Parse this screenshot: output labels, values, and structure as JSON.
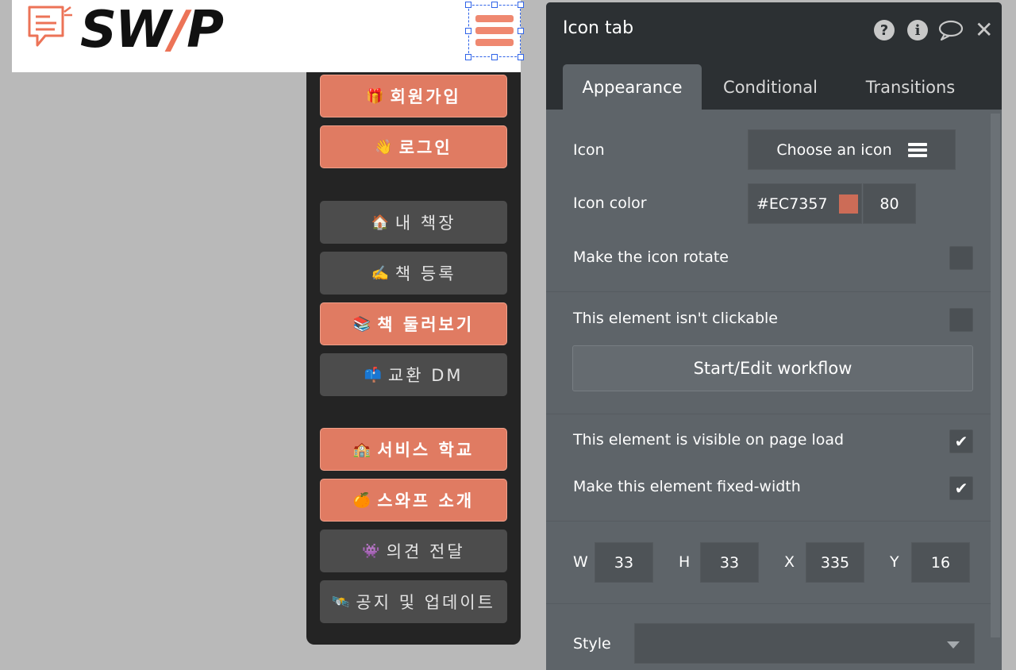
{
  "header": {
    "logo_text": "SWAP",
    "logo_text_main": "SW",
    "logo_text_accent": "/",
    "logo_text_tail": "P",
    "logo_icon": "document-chat-icon",
    "menu_icon": "hamburger-menu-icon"
  },
  "colors": {
    "accent": "#EC7357",
    "menu_dark": "#242424",
    "panel_bg": "#5e6469",
    "panel_header": "#2c3033"
  },
  "menu": {
    "items": [
      {
        "emoji": "🎁",
        "label": "회원가입",
        "style": "orange"
      },
      {
        "emoji": "👋",
        "label": "로그인",
        "style": "orange"
      },
      {
        "emoji": "🏠",
        "label": "내 책장",
        "style": "gray"
      },
      {
        "emoji": "✍️",
        "label": "책 등록",
        "style": "gray"
      },
      {
        "emoji": "📚",
        "label": "책 둘러보기",
        "style": "orange"
      },
      {
        "emoji": "📫",
        "label": "교환 DM",
        "style": "gray"
      },
      {
        "emoji": "🏫",
        "label": "서비스 학교",
        "style": "orange"
      },
      {
        "emoji": "🍊",
        "label": "스와프 소개",
        "style": "orange"
      },
      {
        "emoji": "👾",
        "label": "의견 전달",
        "style": "gray"
      },
      {
        "emoji": "🛰️",
        "label": "공지 및 업데이트",
        "style": "gray"
      }
    ]
  },
  "panel": {
    "title": "Icon tab",
    "help_icon": "?",
    "info_icon": "i",
    "tabs": [
      "Appearance",
      "Conditional",
      "Transitions"
    ],
    "icon_label": "Icon",
    "icon_button": "Choose an icon",
    "icon_color_label": "Icon color",
    "icon_color_value": "#EC7357",
    "icon_opacity": "80",
    "rotate_label": "Make the icon rotate",
    "rotate_checked": false,
    "clickable_label": "This element isn't clickable",
    "clickable_checked": false,
    "workflow_button": "Start/Edit workflow",
    "visible_label": "This element is visible on page load",
    "visible_checked": true,
    "fixed_width_label": "Make this element fixed-width",
    "fixed_width_checked": true,
    "dimensions": {
      "w_label": "W",
      "w": "33",
      "h_label": "H",
      "h": "33",
      "x_label": "X",
      "x": "335",
      "y_label": "Y",
      "y": "16"
    },
    "style_label": "Style",
    "style_value": ""
  }
}
